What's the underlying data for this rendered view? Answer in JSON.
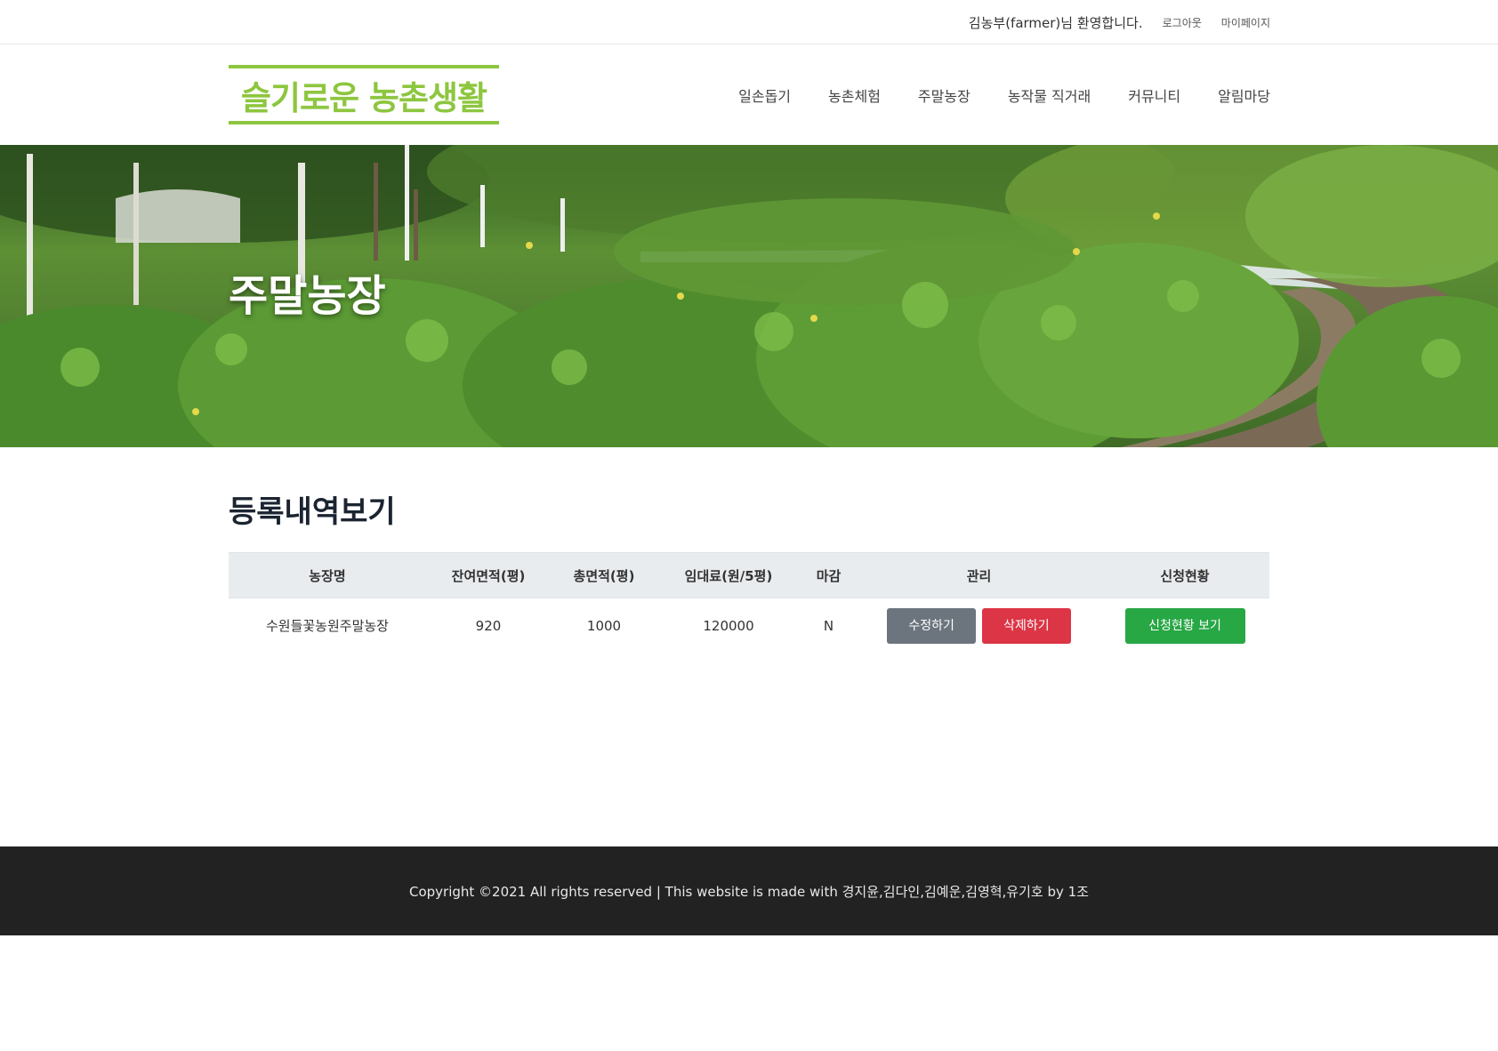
{
  "topbar": {
    "welcome": "김농부(farmer)님 환영합니다.",
    "logout": "로그아웃",
    "mypage": "마이페이지"
  },
  "header": {
    "logo": "슬기로운 농촌생활",
    "nav": [
      "일손돕기",
      "농촌체험",
      "주말농장",
      "농작물 직거래",
      "커뮤니티",
      "알림마당"
    ]
  },
  "hero": {
    "title": "주말농장"
  },
  "main": {
    "section_title": "등록내역보기",
    "table": {
      "headers": [
        "농장명",
        "잔여면적(평)",
        "총면적(평)",
        "임대료(원/5평)",
        "마감",
        "관리",
        "신청현황"
      ],
      "rows": [
        {
          "name": "수원들꽃농원주말농장",
          "remaining_area": "920",
          "total_area": "1000",
          "rent": "120000",
          "closed": "N",
          "edit_label": "수정하기",
          "delete_label": "삭제하기",
          "status_label": "신청현황 보기"
        }
      ]
    }
  },
  "footer": {
    "copyright": "Copyright ©2021 All rights reserved | This website is made with 경지윤,김다인,김예운,김영혁,유기호 by 1조"
  },
  "colors": {
    "brand_green": "#8dc63f",
    "edit_button": "#6c757d",
    "delete_button": "#dc3545",
    "status_button": "#28a745",
    "footer_bg": "#222222"
  }
}
